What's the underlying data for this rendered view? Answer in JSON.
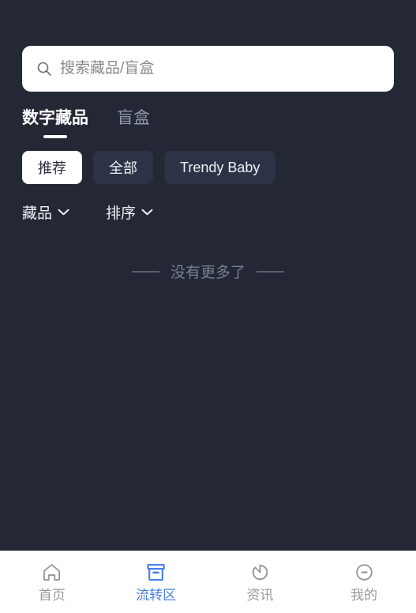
{
  "theme": {
    "background": "#232834",
    "chip_bg": "#2c3346",
    "chip_selected_bg": "#ffffff",
    "accent": "#4a7fe8",
    "nav_bg": "#ffffff",
    "muted_text": "#787f90"
  },
  "search": {
    "icon": "search-icon",
    "placeholder": "搜索藏品/盲盒",
    "value": ""
  },
  "tabs": [
    {
      "label": "数字藏品",
      "active": true
    },
    {
      "label": "盲盒",
      "active": false
    }
  ],
  "chips": [
    {
      "label": "推荐",
      "selected": true
    },
    {
      "label": "全部",
      "selected": false
    },
    {
      "label": "Trendy Baby",
      "selected": false
    }
  ],
  "filters": [
    {
      "label": "藏品",
      "icon": "chevron-down-icon"
    },
    {
      "label": "排序",
      "icon": "chevron-down-icon"
    }
  ],
  "list": {
    "end_text": "没有更多了"
  },
  "bottom_nav": [
    {
      "label": "首页",
      "icon": "home-icon",
      "active": false
    },
    {
      "label": "流转区",
      "icon": "archive-box-icon",
      "active": true
    },
    {
      "label": "资讯",
      "icon": "rotate-clock-icon",
      "active": false
    },
    {
      "label": "我的",
      "icon": "minus-circle-icon",
      "active": false
    }
  ]
}
